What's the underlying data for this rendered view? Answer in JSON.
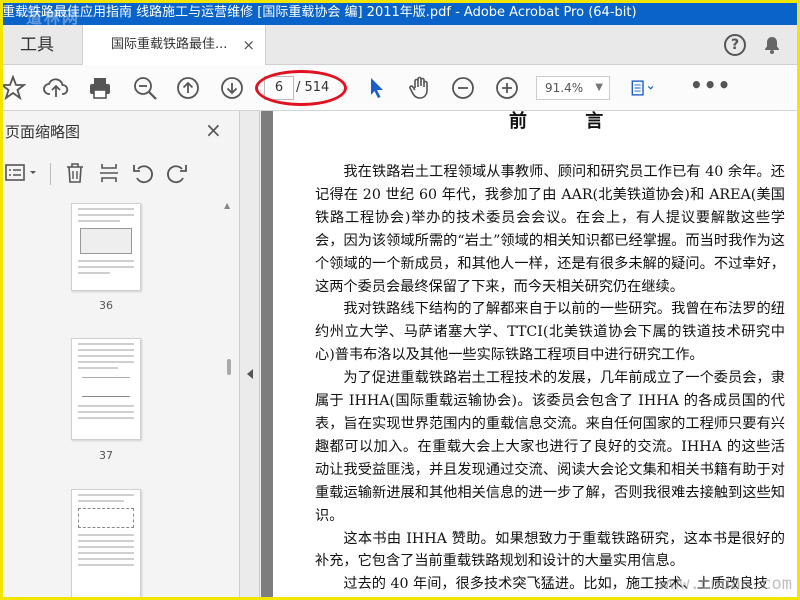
{
  "window": {
    "title": "重载铁路最佳应用指南  线路施工与运营维修 [国际重载协会 编] 2011年版.pdf - Adobe Acrobat Pro (64-bit)",
    "watermark": "道林网"
  },
  "tabs": {
    "tools_label": "工具",
    "doc_tab_label": "国际重载铁路最佳...",
    "doc_tab_close": "×",
    "help_label": "?"
  },
  "toolbar": {
    "page_current": "6",
    "page_total": "/ 514",
    "zoom_value": "91.4%",
    "more": "•••",
    "icons": [
      "star-icon",
      "upload-icon",
      "print-icon",
      "zoom-out-search-icon",
      "page-up-icon",
      "page-down-icon",
      "select-arrow-icon",
      "hand-icon",
      "zoom-minus-icon",
      "zoom-plus-icon",
      "fit-page-icon"
    ],
    "accent_color": "#1a5fc8",
    "highlight_color": "#e0121f"
  },
  "left_panel": {
    "title": "页面缩略图",
    "close": "×",
    "thumbnails": [
      {
        "label": "36"
      },
      {
        "label": "37"
      },
      {
        "label": ""
      }
    ]
  },
  "document": {
    "heading": "前 言",
    "paragraphs": [
      "我在铁路岩土工程领域从事教师、顾问和研究员工作已有 40 余年。还记得在 20 世纪 60 年代，我参加了由 AAR(北美铁道协会)和 AREA(美国铁路工程协会)举办的技术委员会会议。在会上，有人提议要解散这些学会，因为该领域所需的“岩土”领域的相关知识都已经掌握。而当时我作为这个领域的一个新成员，和其他人一样，还是有很多未解的疑问。不过幸好，这两个委员会最终保留了下来，而今天相关研究仍在继续。",
      "我对铁路线下结构的了解都来自于以前的一些研究。我曾在布法罗的纽约州立大学、马萨诸塞大学、TTCI(北美铁道协会下属的铁道技术研究中心)普韦布洛以及其他一些实际铁路工程项目中进行研究工作。",
      "为了促进重载铁路岩土工程技术的发展，几年前成立了一个委员会，隶属于 IHHA(国际重载运输协会)。该委员会包含了 IHHA 的各成员国的代表，旨在实现世界范围内的重载信息交流。来自任何国家的工程师只要有兴趣都可以加入。在重载大会上大家也进行了良好的交流。IHHA 的这些活动让我受益匪浅，并且发现通过交流、阅读大会论文集和相关书籍有助于对重载运输新进展和其他相关信息的进一步了解，否则我很难去接触到这些知识。",
      "这本书由 IHHA 赞助。如果想致力于重载铁路研究，这本书是很好的补充，它包含了当前重载铁路规划和设计的大量实用信息。",
      "过去的 40 年间，很多技术突飞猛进。比如，施工技术、土质改良技"
    ],
    "watermark": "www.cndao.com"
  }
}
